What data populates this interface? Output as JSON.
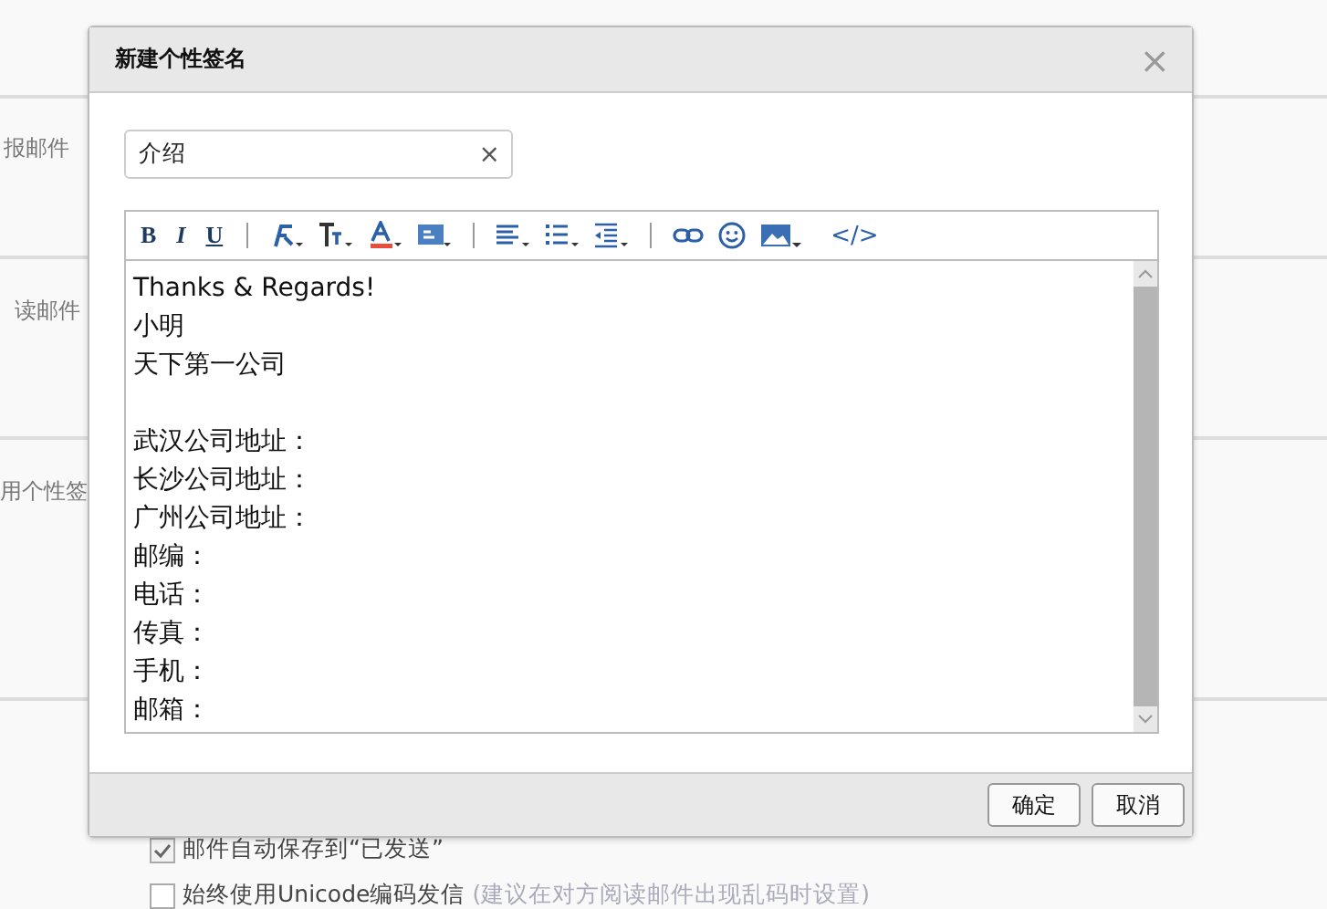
{
  "background": {
    "rows": [
      {
        "label": "报邮件"
      },
      {
        "label": "读邮件"
      },
      {
        "label": "用个性签"
      }
    ],
    "options": [
      {
        "label": "邮件自动保存到“已发送”",
        "checked": true
      },
      {
        "label": "始终使用Unicode编码发信",
        "hint": "(建议在对方阅读邮件出现乱码时设置)",
        "checked": false
      }
    ]
  },
  "dialog": {
    "title": "新建个性签名",
    "close": "×",
    "name_field": {
      "value": "介绍",
      "clear": "×"
    },
    "toolbar": [
      {
        "kind": "bold",
        "glyph": "B"
      },
      {
        "kind": "italic",
        "glyph": "I"
      },
      {
        "kind": "underline",
        "glyph": "U"
      },
      {
        "kind": "separator"
      },
      {
        "kind": "clear-format"
      },
      {
        "kind": "font-size"
      },
      {
        "kind": "font-color"
      },
      {
        "kind": "highlight"
      },
      {
        "kind": "separator"
      },
      {
        "kind": "align"
      },
      {
        "kind": "list"
      },
      {
        "kind": "indent"
      },
      {
        "kind": "separator"
      },
      {
        "kind": "link"
      },
      {
        "kind": "emoji"
      },
      {
        "kind": "image"
      },
      {
        "kind": "source",
        "glyph": "</>"
      }
    ],
    "content": [
      {
        "text": "Thanks & Regards!"
      },
      {
        "text": "小明"
      },
      {
        "text": "天下第一公司"
      },
      {
        "text": "武汉公司地址：",
        "blank_before": true
      },
      {
        "text": "长沙公司地址："
      },
      {
        "text": "广州公司地址："
      },
      {
        "text": "邮编："
      },
      {
        "text": "电话："
      },
      {
        "text": "传真："
      },
      {
        "text": "手机："
      },
      {
        "text": "邮箱："
      }
    ],
    "buttons": [
      {
        "label": "确定"
      },
      {
        "label": "取消"
      }
    ]
  }
}
